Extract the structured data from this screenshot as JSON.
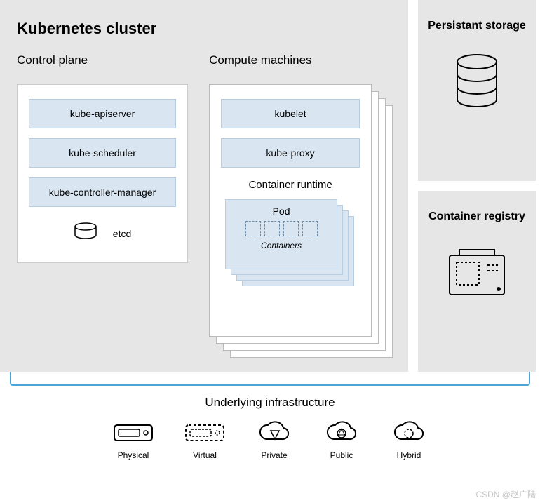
{
  "cluster": {
    "title": "Kubernetes cluster",
    "control_plane": {
      "label": "Control plane",
      "items": [
        "kube-apiserver",
        "kube-scheduler",
        "kube-controller-manager"
      ],
      "etcd_label": "etcd"
    },
    "compute": {
      "label": "Compute machines",
      "items": [
        "kubelet",
        "kube-proxy"
      ],
      "runtime_label": "Container runtime",
      "pod_label": "Pod",
      "containers_label": "Containers",
      "container_count": 4
    }
  },
  "side": {
    "storage": {
      "title": "Persistant storage"
    },
    "registry": {
      "title": "Container registry"
    }
  },
  "infra": {
    "label": "Underlying infrastructure",
    "items": [
      "Physical",
      "Virtual",
      "Private",
      "Public",
      "Hybrid"
    ]
  },
  "watermark": "CSDN @赵广陆"
}
